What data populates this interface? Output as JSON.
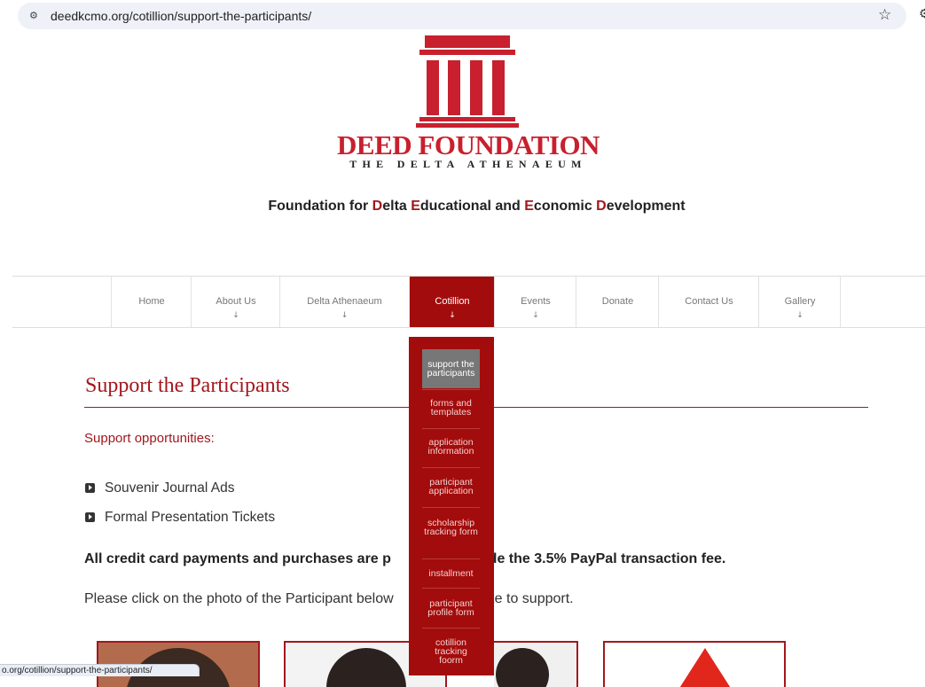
{
  "browser": {
    "url": "deedkcmo.org/cotillion/support-the-participants/",
    "status_url": "o.org/cotillion/support-the-participants/"
  },
  "logo": {
    "title": "DEED FOUNDATION",
    "subtitle": "THE DELTA ATHENAEUM",
    "color": "#c8202e"
  },
  "tagline": {
    "parts": [
      "Foundation for ",
      "D",
      "elta ",
      "E",
      "ducational and ",
      "E",
      "conomic ",
      "D",
      "evelopment"
    ]
  },
  "nav": {
    "items": [
      {
        "label": "Home",
        "arrow": ""
      },
      {
        "label": "About Us",
        "arrow": "↓"
      },
      {
        "label": "Delta Athenaeum",
        "arrow": "↓"
      },
      {
        "label": "Cotillion",
        "arrow": "↓"
      },
      {
        "label": "Events",
        "arrow": "↓"
      },
      {
        "label": "Donate",
        "arrow": ""
      },
      {
        "label": "Contact Us",
        "arrow": ""
      },
      {
        "label": "Gallery",
        "arrow": "↓"
      }
    ],
    "active_color": "#a30c0c"
  },
  "dropdown": {
    "items": [
      {
        "label": "support the participants"
      },
      {
        "label": "forms and templates"
      },
      {
        "label": "application information"
      },
      {
        "label": "participant application"
      },
      {
        "label": "scholarship tracking form"
      },
      {
        "label": "installment"
      },
      {
        "label": "participant profile form"
      },
      {
        "label": "cotillion tracking foorm"
      }
    ]
  },
  "content": {
    "title": "Support the Participants",
    "subhead": "Support opportunities:",
    "bullets": [
      "Souvenir Journal Ads",
      "Formal Presentation Tickets"
    ],
    "notice_left": "All credit card payments and purchases are p",
    "notice_right": "ude the 3.5% PayPal transaction fee.",
    "instr_left": "Please click on the photo of the Participant below",
    "instr_right": "ke to support.",
    "accent": "#a3171d"
  }
}
